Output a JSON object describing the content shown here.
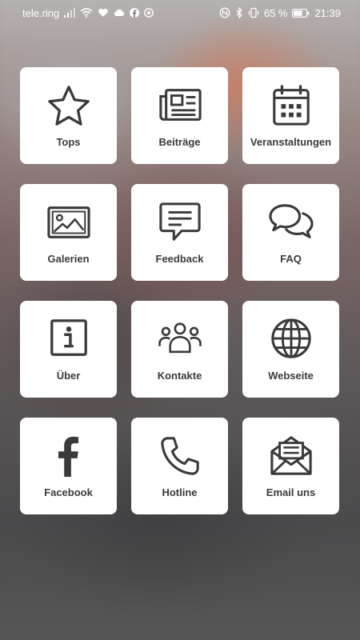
{
  "status_bar": {
    "carrier": "tele.ring",
    "battery": "65 %",
    "time": "21:39",
    "left_icons": [
      "signal-icon",
      "wifi-icon",
      "heart-icon",
      "cloud-icon",
      "facebook-icon",
      "vpn-icon"
    ],
    "right_icons": [
      "nfc-icon",
      "bluetooth-icon",
      "vibrate-icon",
      "battery-icon"
    ]
  },
  "tiles": [
    {
      "label": "Tops",
      "icon": "star-icon"
    },
    {
      "label": "Beiträge",
      "icon": "newspaper-icon"
    },
    {
      "label": "Veranstaltungen",
      "icon": "calendar-icon"
    },
    {
      "label": "Galerien",
      "icon": "image-icon"
    },
    {
      "label": "Feedback",
      "icon": "message-icon"
    },
    {
      "label": "FAQ",
      "icon": "chat-bubbles-icon"
    },
    {
      "label": "Über",
      "icon": "info-icon"
    },
    {
      "label": "Kontakte",
      "icon": "contacts-icon"
    },
    {
      "label": "Webseite",
      "icon": "globe-icon"
    },
    {
      "label": "Facebook",
      "icon": "facebook-icon"
    },
    {
      "label": "Hotline",
      "icon": "phone-icon"
    },
    {
      "label": "Email uns",
      "icon": "envelope-icon"
    }
  ],
  "colors": {
    "tile_background": "#ffffff",
    "icon_color": "#3a3a3a",
    "status_text": "#ffffff"
  }
}
